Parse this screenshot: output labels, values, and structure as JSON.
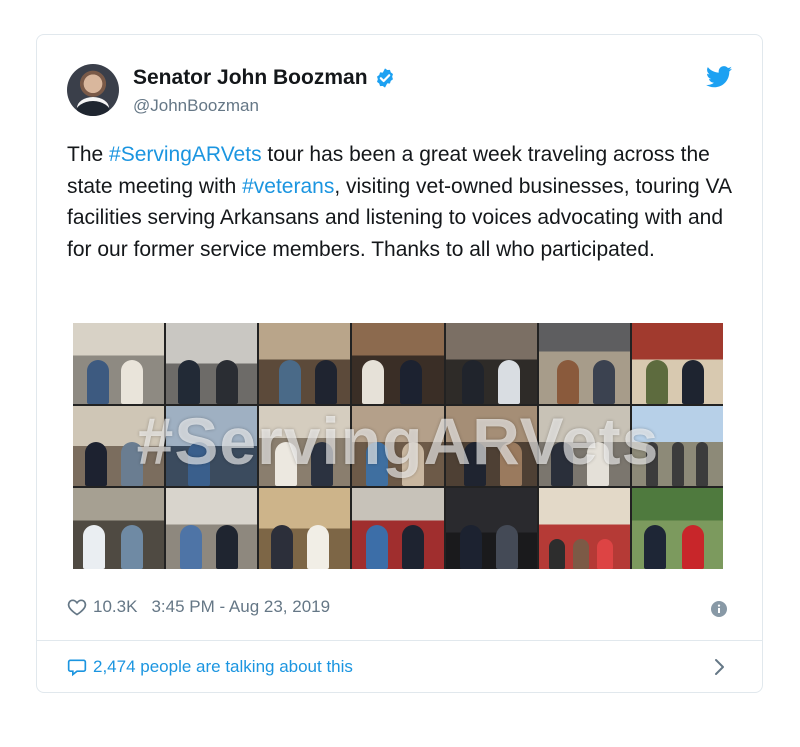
{
  "tweet": {
    "author_name": "Senator John Boozman",
    "author_handle": "@JohnBoozman",
    "text_parts": [
      "The ",
      "#ServingARVets",
      " tour has been a great week traveling across the state meeting with ",
      "#veterans",
      ", visiting vet-owned businesses, touring VA facilities serving Arkansans and listening to voices advocating with and for our former service members. Thanks to all who participated."
    ],
    "image_overlay_text": "#ServingARVets",
    "likes": "10.3K",
    "timestamp": "3:45 PM - Aug 23, 2019",
    "talking_text": "2,474 people are talking about this"
  },
  "colors": {
    "link": "#1b95e0",
    "secondary": "#657786",
    "border": "#e1e8ed"
  },
  "icons": [
    "verified-badge-icon",
    "twitter-bird-icon",
    "heart-icon",
    "info-icon",
    "speech-bubble-icon",
    "chevron-right-icon"
  ]
}
